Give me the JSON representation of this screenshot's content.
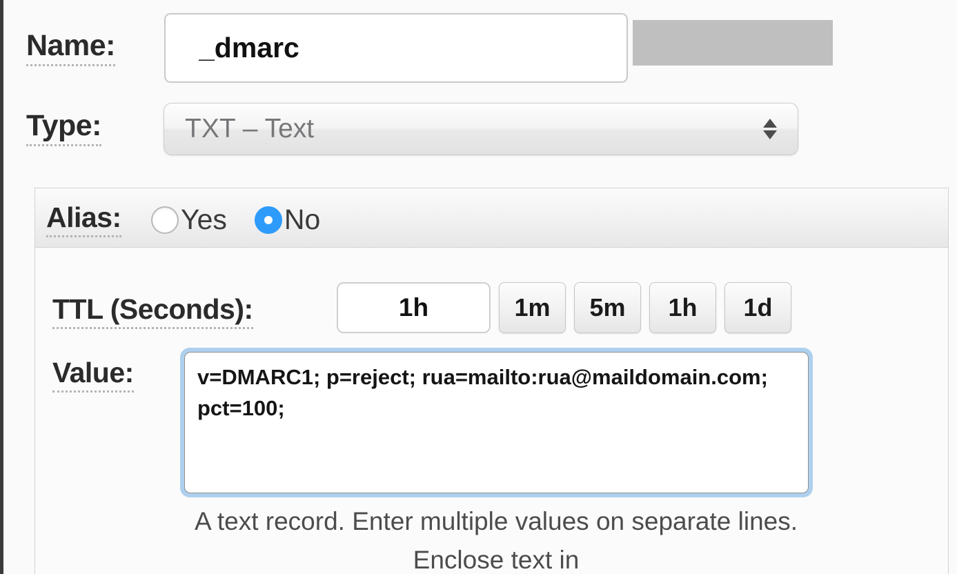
{
  "form": {
    "name": {
      "label": "Name:",
      "value": "_dmarc",
      "placeholder": "",
      "redaction_color": "#bfbfbf"
    },
    "type": {
      "label": "Type:",
      "selected": "TXT – Text",
      "stepper_up_icon": "arrow-up-icon",
      "stepper_down_icon": "arrow-down-icon"
    },
    "alias": {
      "label": "Alias:",
      "options": [
        {
          "label": "Yes",
          "checked": false
        },
        {
          "label": "No",
          "checked": true
        }
      ],
      "checked_color": "#2e9bfa"
    },
    "ttl": {
      "label": "TTL (Seconds):",
      "value": "1h",
      "presets": [
        "1m",
        "5m",
        "1h",
        "1d"
      ]
    },
    "value": {
      "label": "Value:",
      "text": "v=DMARC1; p=reject; rua=mailto:rua@maildomain.com; pct=100;",
      "placeholder": "",
      "focus_ring_color": "#aed0ee",
      "help_text": "A text record. Enter multiple values on separate lines. Enclose text in"
    }
  }
}
